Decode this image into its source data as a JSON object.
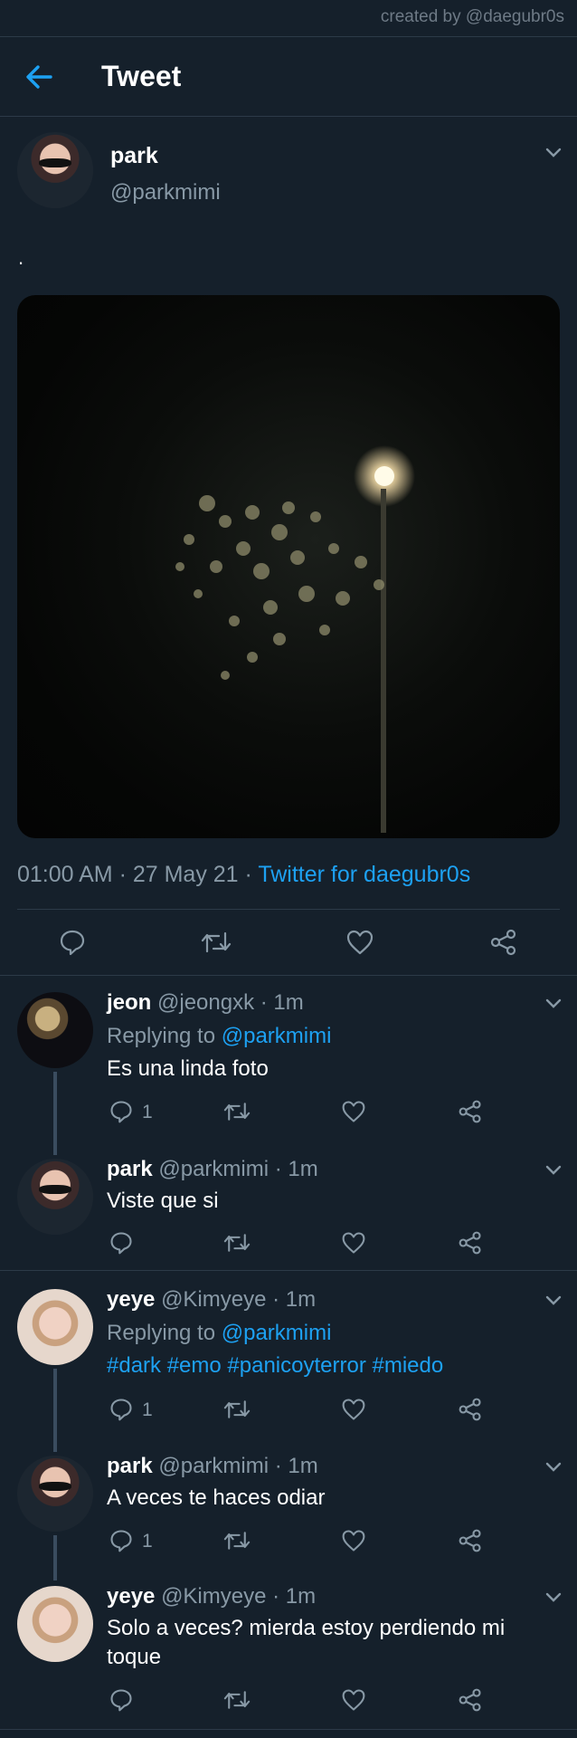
{
  "watermark": "created by @daegubr0s",
  "header": {
    "title": "Tweet"
  },
  "tweet": {
    "name": "park",
    "handle": "@parkmimi",
    "text": ".",
    "time": "01:00 AM · 27 May 21 · ",
    "source": "Twitter for daegubr0s"
  },
  "replies": [
    {
      "name": "jeon",
      "meta": "@jeongxk · 1m",
      "replying_prefix": "Replying to ",
      "replying_to": "@parkmimi",
      "text": "Es una linda foto",
      "reply_count": "1"
    },
    {
      "name": "park",
      "meta": "@parkmimi · 1m",
      "text": "Viste que si",
      "reply_count": ""
    },
    {
      "name": "yeye",
      "meta": "@Kimyeye · 1m",
      "replying_prefix": "Replying to ",
      "replying_to": "@parkmimi",
      "text": "#dark #emo #panicoyterror #miedo",
      "reply_count": "1"
    },
    {
      "name": "park",
      "meta": "@parkmimi · 1m",
      "text": "A veces te haces odiar",
      "reply_count": "1"
    },
    {
      "name": "yeye",
      "meta": "@Kimyeye · 1m",
      "text": "Solo a veces? mierda estoy perdiendo mi toque",
      "reply_count": ""
    }
  ],
  "colors": {
    "background": "#15202b",
    "accent": "#1da1f2",
    "muted": "#8899a6",
    "thread_line": "#3a4c5f"
  },
  "icons": [
    "back-arrow-icon",
    "chevron-down-icon",
    "reply-icon",
    "retweet-icon",
    "like-icon",
    "share-icon"
  ]
}
